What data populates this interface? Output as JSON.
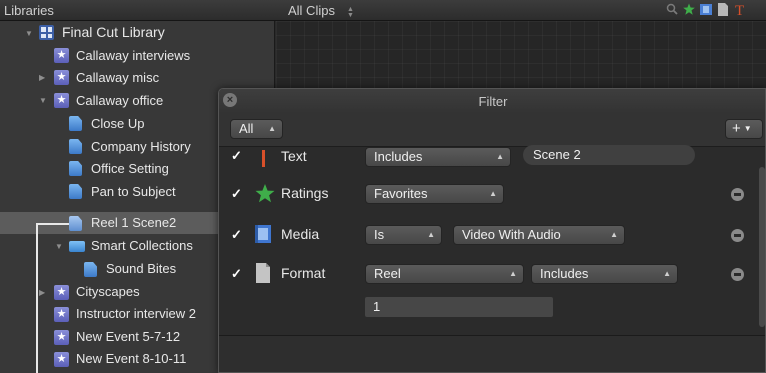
{
  "header": {
    "libraries_label": "Libraries",
    "clips_filter_label": "All Clips",
    "clips_filter_arrows": "▲▼"
  },
  "sidebar": {
    "items": [
      {
        "label": "Final Cut Library",
        "icon": "library-icon",
        "disclosure": "expanded"
      },
      {
        "label": "Callaway interviews",
        "icon": "event-star-icon"
      },
      {
        "label": "Callaway misc",
        "icon": "event-star-icon",
        "disclosure": "collapsed"
      },
      {
        "label": "Callaway office",
        "icon": "event-star-icon",
        "disclosure": "expanded"
      },
      {
        "label": "Close Up",
        "icon": "keyword-collection-icon"
      },
      {
        "label": "Company History",
        "icon": "keyword-collection-icon"
      },
      {
        "label": "Office Setting",
        "icon": "keyword-collection-icon"
      },
      {
        "label": "Pan to Subject",
        "icon": "keyword-collection-icon"
      },
      {
        "label": "Reel 1 Scene2",
        "icon": "smart-collection-icon",
        "selected": true
      },
      {
        "label": "Smart Collections",
        "icon": "folder-icon",
        "disclosure": "expanded"
      },
      {
        "label": "Sound Bites",
        "icon": "keyword-collection-icon"
      },
      {
        "label": "Cityscapes",
        "icon": "event-star-icon",
        "disclosure": "collapsed"
      },
      {
        "label": "Instructor interview 2",
        "icon": "event-star-icon"
      },
      {
        "label": "New Event 5-7-12",
        "icon": "event-star-icon"
      },
      {
        "label": "New Event 8-10-11",
        "icon": "event-star-icon"
      }
    ]
  },
  "filter_window": {
    "title": "Filter",
    "close_symbol": "×",
    "match_popup": "All",
    "add_button": "+",
    "rules": [
      {
        "checked": "✓",
        "label": "Text",
        "icon": "text-t-icon",
        "operator": "Includes",
        "value": "Scene 2"
      },
      {
        "checked": "✓",
        "label": "Ratings",
        "icon": "green-star-icon",
        "operator": "Favorites"
      },
      {
        "checked": "✓",
        "label": "Media",
        "icon": "film-icon",
        "operator": "Is",
        "value": "Video With Audio"
      },
      {
        "checked": "✓",
        "label": "Format",
        "icon": "document-icon",
        "operator": "Reel",
        "second_operator": "Includes",
        "value": "1"
      }
    ]
  },
  "colors": {
    "selection": "#5c5c5c",
    "event_icon": "#6d72c8",
    "ratings_star": "#3fae4a",
    "text_rule_icon": "#d8502a"
  }
}
